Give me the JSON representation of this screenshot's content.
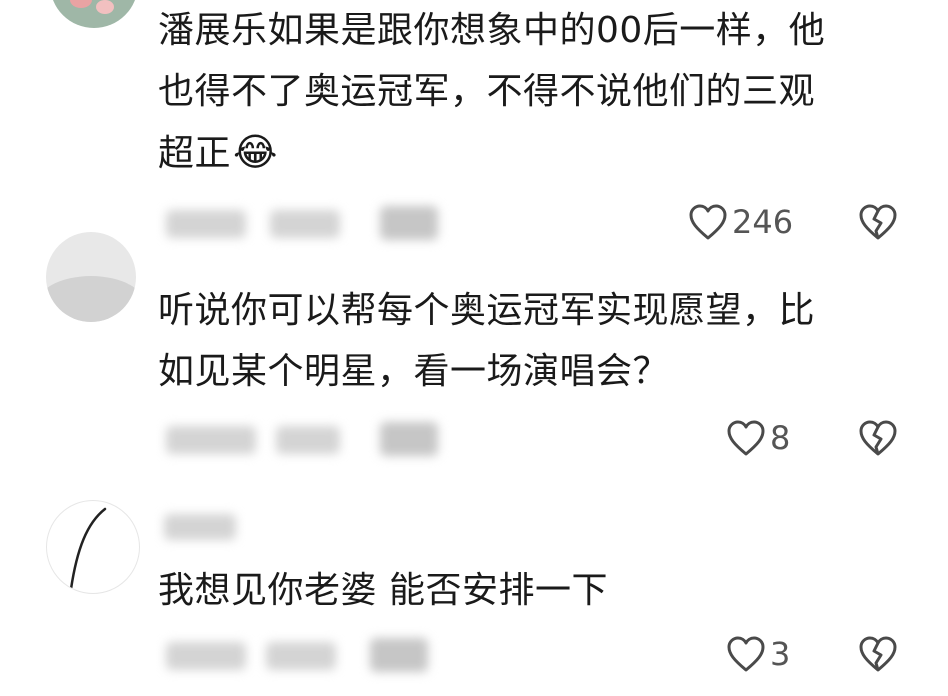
{
  "comments": [
    {
      "lines": [
        "潘展乐如果是跟你想象中的00后一样，他",
        "也得不了奥运冠军，不得不说他们的三观",
        "超正"
      ],
      "emoji": "😂",
      "likes": "246"
    },
    {
      "lines": [
        "听说你可以帮每个奥运冠军实现愿望，比",
        "如见某个明星，看一场演唱会？"
      ],
      "likes": "8"
    },
    {
      "lines": [
        "我想见你老婆 能否安排一下"
      ],
      "likes": "3"
    }
  ],
  "colors": {
    "icon": "#4a4a4a",
    "text": "#1a1a1a",
    "blur": "#d4d4d4"
  }
}
